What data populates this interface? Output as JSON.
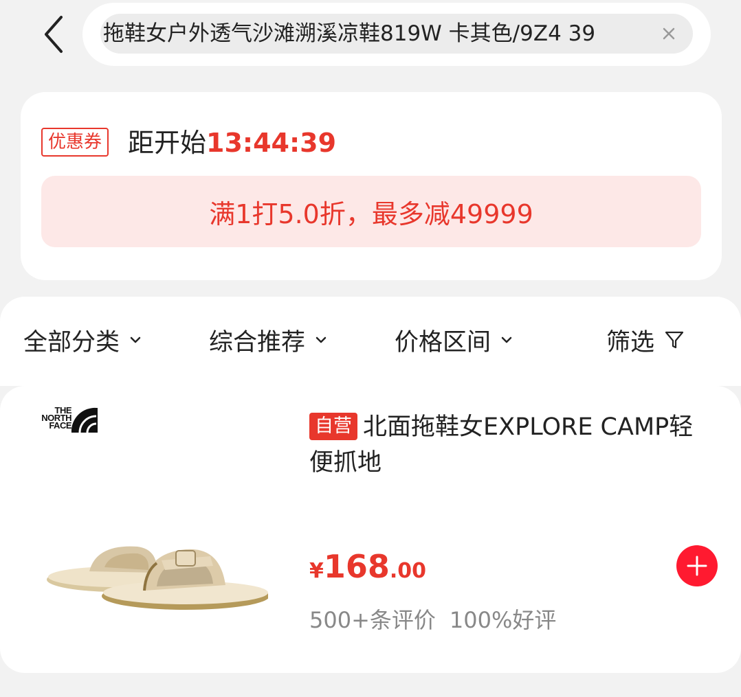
{
  "header": {
    "back_icon": "chevron-left-icon",
    "search_query": "拖鞋女户外透气沙滩溯溪凉鞋819W 卡其色/9Z4 39",
    "clear_icon": "close-icon"
  },
  "coupon": {
    "tag": "优惠券",
    "countdown_label": "距开始",
    "countdown_time": "13:44:39",
    "discount_text": "满1打5.0折，最多减49999"
  },
  "filters": [
    {
      "label": "全部分类",
      "icon": "chevron-down-icon"
    },
    {
      "label": "综合推荐",
      "icon": "chevron-down-icon"
    },
    {
      "label": "价格区间",
      "icon": "chevron-down-icon"
    },
    {
      "label": "筛选",
      "icon": "filter-funnel-icon"
    }
  ],
  "product": {
    "brand_logo_text": "THE NORTH FACE",
    "badge": "自营",
    "title": "北面拖鞋女EXPLORE CAMP轻便抓地",
    "price_currency": "¥",
    "price_integer": "168",
    "price_decimal": ".00",
    "review_count": "500+条评价",
    "positive_rate": "100%好评",
    "add_icon": "plus-icon"
  },
  "colors": {
    "accent_red": "#e8372c",
    "cart_red": "#ff1a30",
    "coupon_bg": "#fde8e7",
    "page_bg": "#f2f2f2"
  }
}
